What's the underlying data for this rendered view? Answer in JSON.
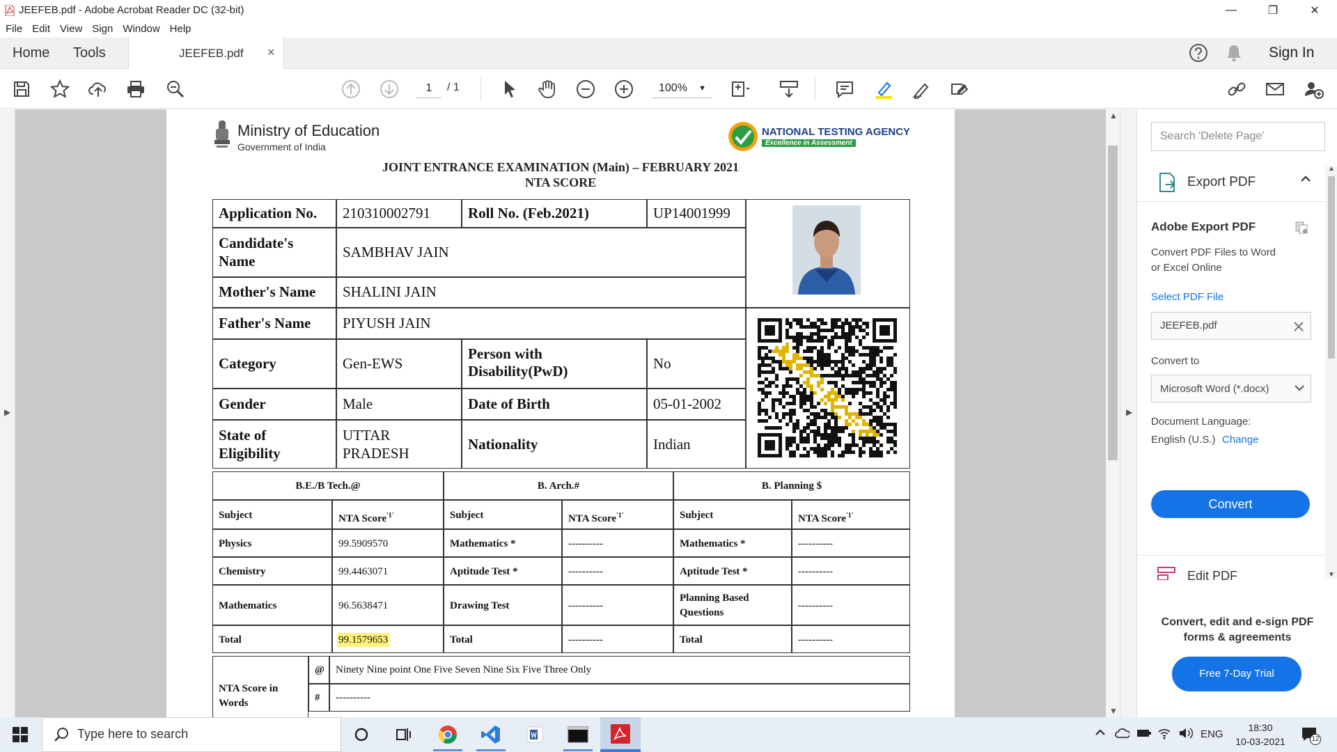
{
  "window": {
    "title": "JEEFEB.pdf - Adobe Acrobat Reader DC (32-bit)",
    "controls": [
      "—",
      "❐",
      "✕"
    ]
  },
  "menu": [
    "File",
    "Edit",
    "View",
    "Sign",
    "Window",
    "Help"
  ],
  "tabs": {
    "home": "Home",
    "tools": "Tools",
    "file": "JEEFEB.pdf",
    "close": "×",
    "signin": "Sign In"
  },
  "toolbar": {
    "page_current": "1",
    "page_total": "/ 1",
    "zoom": "100%"
  },
  "document": {
    "ministry": "Ministry of Education",
    "government": "Government of India",
    "agency": "NATIONAL TESTING AGENCY",
    "agency_tag": "Excellence in Assessment",
    "title_line1": "JOINT ENTRANCE EXAMINATION (Main) – FEBRUARY 2021",
    "title_line2": "NTA SCORE",
    "fields": {
      "application_no_label": "Application No.",
      "application_no": "210310002791",
      "roll_no_label": "Roll No. (Feb.2021)",
      "roll_no": "UP14001999",
      "candidate_name_label_1": "Candidate's",
      "candidate_name_label_2": "Name",
      "candidate_name": "SAMBHAV JAIN",
      "mother_name_label": "Mother's Name",
      "mother_name": "SHALINI JAIN",
      "father_name_label": "Father's Name",
      "father_name": "PIYUSH JAIN",
      "category_label": "Category",
      "category": "Gen-EWS",
      "pwd_label_1": "Person with",
      "pwd_label_2": "Disability(PwD)",
      "pwd": "No",
      "gender_label": "Gender",
      "gender": "Male",
      "dob_label": "Date of Birth",
      "dob": "05-01-2002",
      "state_label_1": "State  of",
      "state_label_2": "Eligibility",
      "state_1": "UTTAR",
      "state_2": "PRADESH",
      "nationality_label": "Nationality",
      "nationality": "Indian"
    },
    "scores": {
      "headers": [
        "B.E./B Tech.@",
        "B. Arch.#",
        "B. Planning $"
      ],
      "subject_label": "Subject",
      "score_label": "NTA Score",
      "score_sup": "'1'",
      "betech": [
        {
          "subject": "Physics",
          "score": "99.5909570"
        },
        {
          "subject": "Chemistry",
          "score": "99.4463071"
        },
        {
          "subject": "Mathematics",
          "score": "96.5638471"
        },
        {
          "subject": "Total",
          "score": "99.1579653"
        }
      ],
      "barch": [
        {
          "subject": "Mathematics *",
          "score": "----------"
        },
        {
          "subject": "Aptitude Test *",
          "score": "----------"
        },
        {
          "subject": "Drawing Test",
          "score": "----------"
        },
        {
          "subject": "Total",
          "score": "----------"
        }
      ],
      "bplan": [
        {
          "subject": "Mathematics *",
          "score": "----------"
        },
        {
          "subject": "Aptitude Test *",
          "score": "----------"
        },
        {
          "subject_1": "Planning Based",
          "subject_2": "Questions",
          "score": "----------"
        },
        {
          "subject": "Total",
          "score": "----------"
        }
      ],
      "words_label_1": "NTA Score in",
      "words_label_2": "Words",
      "words_rows": [
        {
          "mark": "@",
          "text": "Ninety Nine point One Five Seven Nine Six Five Three Only"
        },
        {
          "mark": "#",
          "text": "----------"
        }
      ]
    }
  },
  "panel": {
    "search_placeholder": "Search 'Delete Page'",
    "export_title": "Export PDF",
    "adobe_export": "Adobe Export PDF",
    "desc_1": "Convert PDF Files to Word",
    "desc_2": "or Excel Online",
    "select_file": "Select PDF File",
    "file_value": "JEEFEB.pdf",
    "convert_to": "Convert to",
    "format": "Microsoft Word (*.docx)",
    "doc_lang": "Document Language:",
    "lang": "English (U.S.)",
    "change": "Change",
    "convert_btn": "Convert",
    "edit_pdf": "Edit PDF",
    "promo_1": "Convert, edit and e-sign PDF",
    "promo_2": "forms & agreements",
    "trial_btn": "Free 7-Day Trial"
  },
  "taskbar": {
    "search_placeholder": "Type here to search",
    "lang": "ENG",
    "time": "18:30",
    "date": "10-03-2021",
    "notif_count": "12"
  },
  "colors": {
    "accent": "#1473e6",
    "acrobat_red": "#d4242c",
    "highlight": "#fff27a"
  }
}
